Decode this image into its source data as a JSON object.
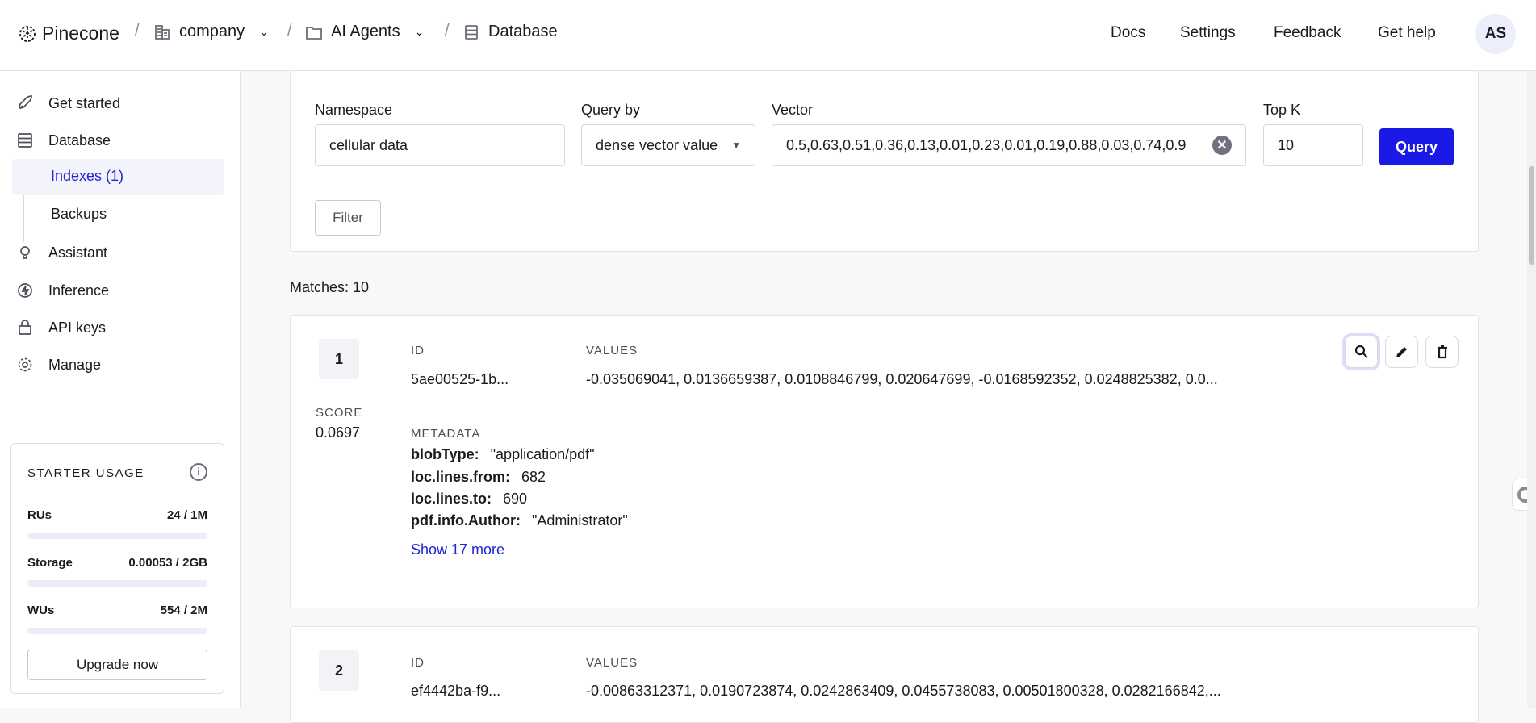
{
  "header": {
    "brand": "Pinecone",
    "org": "company",
    "project": "AI Agents",
    "section": "Database",
    "links": [
      "Docs",
      "Settings",
      "Feedback",
      "Get help"
    ],
    "avatar": "AS"
  },
  "sidebar": {
    "items": [
      "Get started",
      "Database",
      "Indexes (1)",
      "Backups",
      "Assistant",
      "Inference",
      "API keys",
      "Manage"
    ],
    "usage": {
      "title": "STARTER USAGE",
      "rows": [
        {
          "label": "RUs",
          "value": "24 / 1M",
          "fraction": 2e-05
        },
        {
          "label": "Storage",
          "value": "0.00053 / 2GB",
          "fraction": 0.0003
        },
        {
          "label": "WUs",
          "value": "554 / 2M",
          "fraction": 0.0003
        }
      ],
      "upgrade": "Upgrade now"
    }
  },
  "query": {
    "namespace_label": "Namespace",
    "namespace": "cellular data",
    "queryby_label": "Query by",
    "queryby": "dense vector value",
    "vector_label": "Vector",
    "vector": "0.5,0.63,0.51,0.36,0.13,0.01,0.23,0.01,0.19,0.88,0.03,0.74,0.9",
    "topk_label": "Top K",
    "topk": "10",
    "query_button": "Query",
    "filter_button": "Filter"
  },
  "matches_label": "Matches: 10",
  "labels": {
    "id": "ID",
    "values": "VALUES",
    "score": "SCORE",
    "metadata": "METADATA"
  },
  "results": [
    {
      "rank": "1",
      "id": "5ae00525-1b...",
      "values": "-0.035069041, 0.0136659387, 0.0108846799, 0.020647699, -0.0168592352, 0.0248825382, 0.0...",
      "score": "0.0697",
      "metadata": [
        {
          "k": "blobType:",
          "v": "\"application/pdf\""
        },
        {
          "k": "loc.lines.from:",
          "v": "682"
        },
        {
          "k": "loc.lines.to:",
          "v": "690"
        },
        {
          "k": "pdf.info.Author:",
          "v": "\"Administrator\""
        }
      ],
      "show_more": "Show 17 more"
    },
    {
      "rank": "2",
      "id": "ef4442ba-f9...",
      "values": "-0.00863312371, 0.0190723874, 0.0242863409, 0.0455738083, 0.00501800328, 0.0282166842,..."
    }
  ],
  "colors": {
    "accent": "#1a1ae6",
    "link": "#2323d6",
    "active_bg": "#f3f3fb"
  }
}
